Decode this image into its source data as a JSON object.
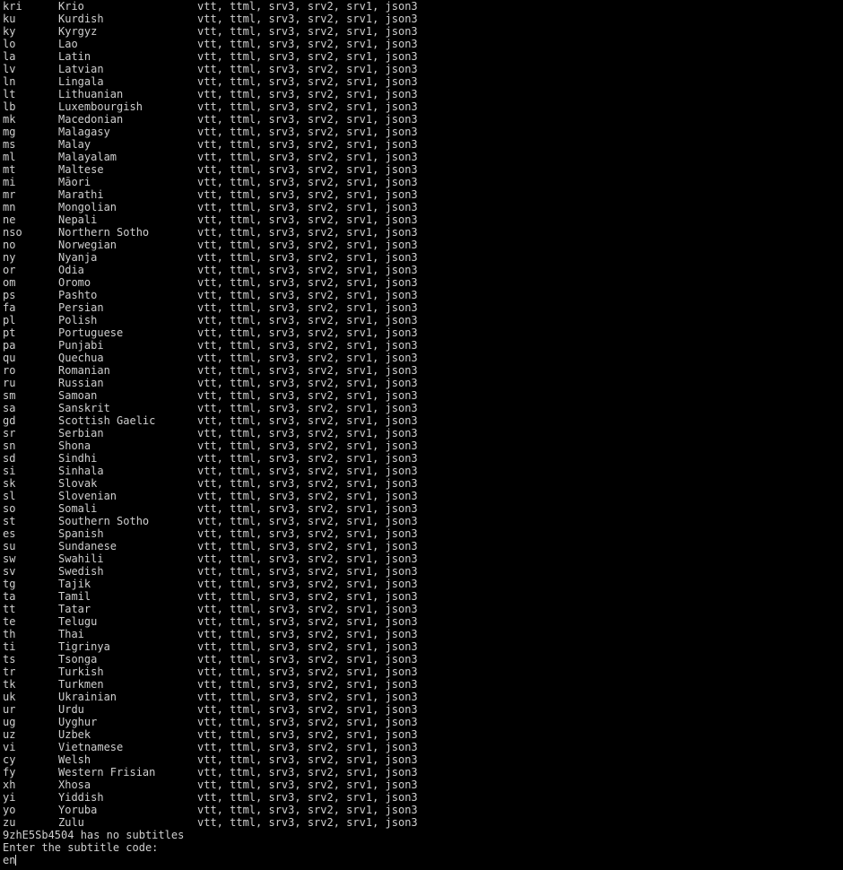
{
  "terminal": {
    "background_color": "#000000",
    "foreground_color": "#cfcfcf",
    "cursor_color": "#d8d8d8"
  },
  "subtitle_table": {
    "formats_string": "vtt, ttml, srv3, srv2, srv1, json3",
    "rows": [
      {
        "code": "kri",
        "name": "Krio",
        "formats": "vtt, ttml, srv3, srv2, srv1, json3"
      },
      {
        "code": "ku",
        "name": "Kurdish",
        "formats": "vtt, ttml, srv3, srv2, srv1, json3"
      },
      {
        "code": "ky",
        "name": "Kyrgyz",
        "formats": "vtt, ttml, srv3, srv2, srv1, json3"
      },
      {
        "code": "lo",
        "name": "Lao",
        "formats": "vtt, ttml, srv3, srv2, srv1, json3"
      },
      {
        "code": "la",
        "name": "Latin",
        "formats": "vtt, ttml, srv3, srv2, srv1, json3"
      },
      {
        "code": "lv",
        "name": "Latvian",
        "formats": "vtt, ttml, srv3, srv2, srv1, json3"
      },
      {
        "code": "ln",
        "name": "Lingala",
        "formats": "vtt, ttml, srv3, srv2, srv1, json3"
      },
      {
        "code": "lt",
        "name": "Lithuanian",
        "formats": "vtt, ttml, srv3, srv2, srv1, json3"
      },
      {
        "code": "lb",
        "name": "Luxembourgish",
        "formats": "vtt, ttml, srv3, srv2, srv1, json3"
      },
      {
        "code": "mk",
        "name": "Macedonian",
        "formats": "vtt, ttml, srv3, srv2, srv1, json3"
      },
      {
        "code": "mg",
        "name": "Malagasy",
        "formats": "vtt, ttml, srv3, srv2, srv1, json3"
      },
      {
        "code": "ms",
        "name": "Malay",
        "formats": "vtt, ttml, srv3, srv2, srv1, json3"
      },
      {
        "code": "ml",
        "name": "Malayalam",
        "formats": "vtt, ttml, srv3, srv2, srv1, json3"
      },
      {
        "code": "mt",
        "name": "Maltese",
        "formats": "vtt, ttml, srv3, srv2, srv1, json3"
      },
      {
        "code": "mi",
        "name": "Māori",
        "formats": "vtt, ttml, srv3, srv2, srv1, json3"
      },
      {
        "code": "mr",
        "name": "Marathi",
        "formats": "vtt, ttml, srv3, srv2, srv1, json3"
      },
      {
        "code": "mn",
        "name": "Mongolian",
        "formats": "vtt, ttml, srv3, srv2, srv1, json3"
      },
      {
        "code": "ne",
        "name": "Nepali",
        "formats": "vtt, ttml, srv3, srv2, srv1, json3"
      },
      {
        "code": "nso",
        "name": "Northern Sotho",
        "formats": "vtt, ttml, srv3, srv2, srv1, json3"
      },
      {
        "code": "no",
        "name": "Norwegian",
        "formats": "vtt, ttml, srv3, srv2, srv1, json3"
      },
      {
        "code": "ny",
        "name": "Nyanja",
        "formats": "vtt, ttml, srv3, srv2, srv1, json3"
      },
      {
        "code": "or",
        "name": "Odia",
        "formats": "vtt, ttml, srv3, srv2, srv1, json3"
      },
      {
        "code": "om",
        "name": "Oromo",
        "formats": "vtt, ttml, srv3, srv2, srv1, json3"
      },
      {
        "code": "ps",
        "name": "Pashto",
        "formats": "vtt, ttml, srv3, srv2, srv1, json3"
      },
      {
        "code": "fa",
        "name": "Persian",
        "formats": "vtt, ttml, srv3, srv2, srv1, json3"
      },
      {
        "code": "pl",
        "name": "Polish",
        "formats": "vtt, ttml, srv3, srv2, srv1, json3"
      },
      {
        "code": "pt",
        "name": "Portuguese",
        "formats": "vtt, ttml, srv3, srv2, srv1, json3"
      },
      {
        "code": "pa",
        "name": "Punjabi",
        "formats": "vtt, ttml, srv3, srv2, srv1, json3"
      },
      {
        "code": "qu",
        "name": "Quechua",
        "formats": "vtt, ttml, srv3, srv2, srv1, json3"
      },
      {
        "code": "ro",
        "name": "Romanian",
        "formats": "vtt, ttml, srv3, srv2, srv1, json3"
      },
      {
        "code": "ru",
        "name": "Russian",
        "formats": "vtt, ttml, srv3, srv2, srv1, json3"
      },
      {
        "code": "sm",
        "name": "Samoan",
        "formats": "vtt, ttml, srv3, srv2, srv1, json3"
      },
      {
        "code": "sa",
        "name": "Sanskrit",
        "formats": "vtt, ttml, srv3, srv2, srv1, json3"
      },
      {
        "code": "gd",
        "name": "Scottish Gaelic",
        "formats": "vtt, ttml, srv3, srv2, srv1, json3"
      },
      {
        "code": "sr",
        "name": "Serbian",
        "formats": "vtt, ttml, srv3, srv2, srv1, json3"
      },
      {
        "code": "sn",
        "name": "Shona",
        "formats": "vtt, ttml, srv3, srv2, srv1, json3"
      },
      {
        "code": "sd",
        "name": "Sindhi",
        "formats": "vtt, ttml, srv3, srv2, srv1, json3"
      },
      {
        "code": "si",
        "name": "Sinhala",
        "formats": "vtt, ttml, srv3, srv2, srv1, json3"
      },
      {
        "code": "sk",
        "name": "Slovak",
        "formats": "vtt, ttml, srv3, srv2, srv1, json3"
      },
      {
        "code": "sl",
        "name": "Slovenian",
        "formats": "vtt, ttml, srv3, srv2, srv1, json3"
      },
      {
        "code": "so",
        "name": "Somali",
        "formats": "vtt, ttml, srv3, srv2, srv1, json3"
      },
      {
        "code": "st",
        "name": "Southern Sotho",
        "formats": "vtt, ttml, srv3, srv2, srv1, json3"
      },
      {
        "code": "es",
        "name": "Spanish",
        "formats": "vtt, ttml, srv3, srv2, srv1, json3"
      },
      {
        "code": "su",
        "name": "Sundanese",
        "formats": "vtt, ttml, srv3, srv2, srv1, json3"
      },
      {
        "code": "sw",
        "name": "Swahili",
        "formats": "vtt, ttml, srv3, srv2, srv1, json3"
      },
      {
        "code": "sv",
        "name": "Swedish",
        "formats": "vtt, ttml, srv3, srv2, srv1, json3"
      },
      {
        "code": "tg",
        "name": "Tajik",
        "formats": "vtt, ttml, srv3, srv2, srv1, json3"
      },
      {
        "code": "ta",
        "name": "Tamil",
        "formats": "vtt, ttml, srv3, srv2, srv1, json3"
      },
      {
        "code": "tt",
        "name": "Tatar",
        "formats": "vtt, ttml, srv3, srv2, srv1, json3"
      },
      {
        "code": "te",
        "name": "Telugu",
        "formats": "vtt, ttml, srv3, srv2, srv1, json3"
      },
      {
        "code": "th",
        "name": "Thai",
        "formats": "vtt, ttml, srv3, srv2, srv1, json3"
      },
      {
        "code": "ti",
        "name": "Tigrinya",
        "formats": "vtt, ttml, srv3, srv2, srv1, json3"
      },
      {
        "code": "ts",
        "name": "Tsonga",
        "formats": "vtt, ttml, srv3, srv2, srv1, json3"
      },
      {
        "code": "tr",
        "name": "Turkish",
        "formats": "vtt, ttml, srv3, srv2, srv1, json3"
      },
      {
        "code": "tk",
        "name": "Turkmen",
        "formats": "vtt, ttml, srv3, srv2, srv1, json3"
      },
      {
        "code": "uk",
        "name": "Ukrainian",
        "formats": "vtt, ttml, srv3, srv2, srv1, json3"
      },
      {
        "code": "ur",
        "name": "Urdu",
        "formats": "vtt, ttml, srv3, srv2, srv1, json3"
      },
      {
        "code": "ug",
        "name": "Uyghur",
        "formats": "vtt, ttml, srv3, srv2, srv1, json3"
      },
      {
        "code": "uz",
        "name": "Uzbek",
        "formats": "vtt, ttml, srv3, srv2, srv1, json3"
      },
      {
        "code": "vi",
        "name": "Vietnamese",
        "formats": "vtt, ttml, srv3, srv2, srv1, json3"
      },
      {
        "code": "cy",
        "name": "Welsh",
        "formats": "vtt, ttml, srv3, srv2, srv1, json3"
      },
      {
        "code": "fy",
        "name": "Western Frisian",
        "formats": "vtt, ttml, srv3, srv2, srv1, json3"
      },
      {
        "code": "xh",
        "name": "Xhosa",
        "formats": "vtt, ttml, srv3, srv2, srv1, json3"
      },
      {
        "code": "yi",
        "name": "Yiddish",
        "formats": "vtt, ttml, srv3, srv2, srv1, json3"
      },
      {
        "code": "yo",
        "name": "Yoruba",
        "formats": "vtt, ttml, srv3, srv2, srv1, json3"
      },
      {
        "code": "zu",
        "name": "Zulu",
        "formats": "vtt, ttml, srv3, srv2, srv1, json3"
      }
    ]
  },
  "status_message": "9zhE5Sb4504 has no subtitles",
  "prompt": {
    "label": "Enter the subtitle code:",
    "typed_value": "en"
  }
}
